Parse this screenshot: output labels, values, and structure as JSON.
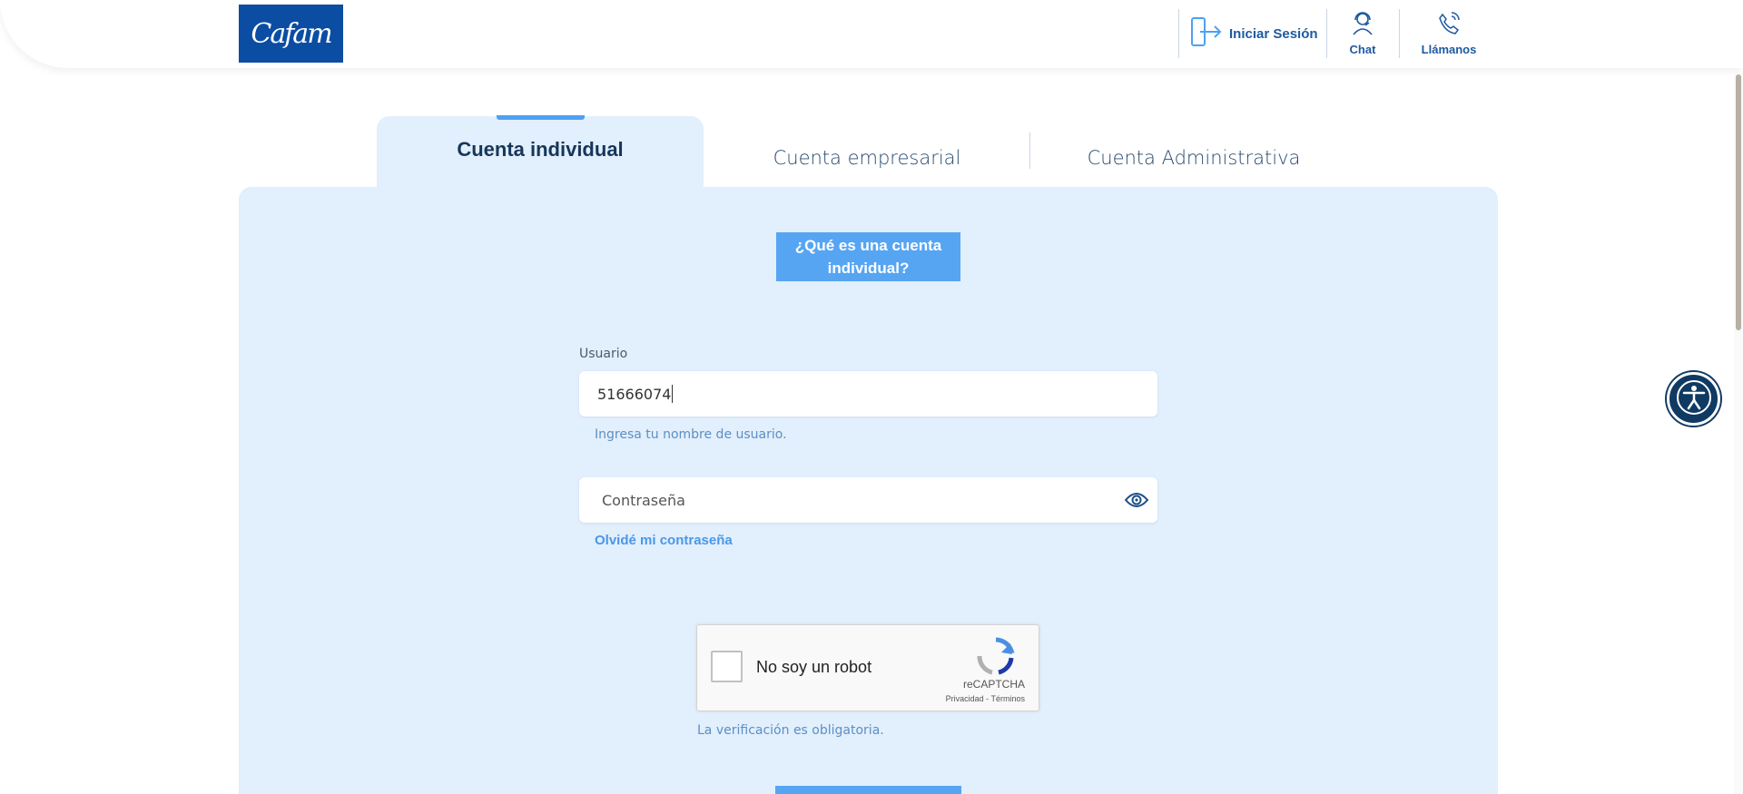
{
  "header": {
    "logo_text": "Cafam",
    "login_label": "Iniciar Sesión",
    "chat_label": "Chat",
    "call_label": "Llámanos"
  },
  "tabs": [
    {
      "label": "Cuenta individual",
      "active": true
    },
    {
      "label": "Cuenta empresarial",
      "active": false
    },
    {
      "label": "Cuenta Administrativa",
      "active": false
    }
  ],
  "form": {
    "what_is_label": "¿Qué es una cuenta individual?",
    "user_label": "Usuario",
    "user_value": "51666074",
    "user_hint": "Ingresa tu nombre de usuario.",
    "password_placeholder": "Contraseña",
    "forgot_label": "Olvidé mi contraseña"
  },
  "captcha": {
    "label": "No soy un robot",
    "brand": "reCAPTCHA",
    "privacy": "Privacidad",
    "separator": " - ",
    "terms": "Términos",
    "required_msg": "La verificación es obligatoria."
  },
  "colors": {
    "brand_blue": "#0b4da2",
    "panel_bg": "#e2effc",
    "accent": "#56a5f3",
    "title_dark": "#17365b"
  },
  "icons": {
    "login": "door-exit-icon",
    "chat": "headset-agent-icon",
    "call": "phone-ringing-icon",
    "eye": "eye-icon",
    "accessibility": "accessibility-person-icon"
  }
}
